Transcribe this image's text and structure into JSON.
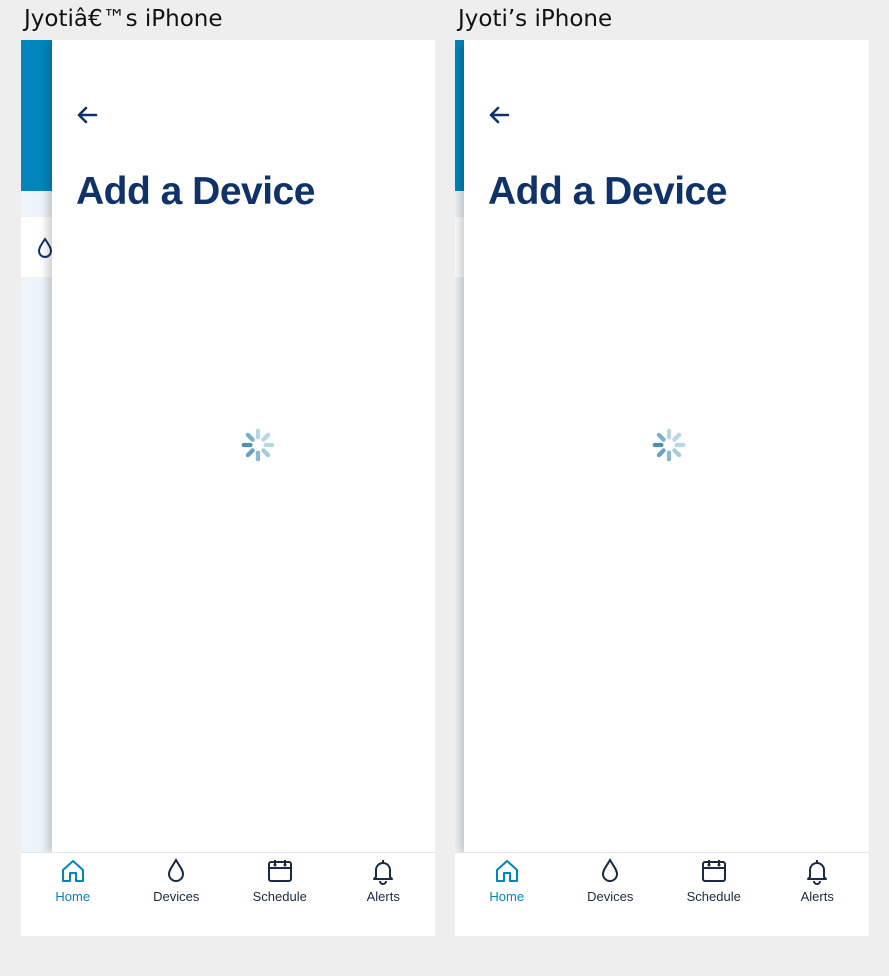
{
  "devices": [
    {
      "label": "Jyotiâ€™s iPhone",
      "title": "Add a Device",
      "tabs": [
        {
          "label": "Home",
          "icon": "home-icon",
          "active": true
        },
        {
          "label": "Devices",
          "icon": "water-drop-icon",
          "active": false
        },
        {
          "label": "Schedule",
          "icon": "calendar-icon",
          "active": false
        },
        {
          "label": "Alerts",
          "icon": "bell-icon",
          "active": false
        }
      ]
    },
    {
      "label": "Jyoti’s iPhone",
      "title": "Add a Device",
      "tabs": [
        {
          "label": "Home",
          "icon": "home-icon",
          "active": true
        },
        {
          "label": "Devices",
          "icon": "water-drop-icon",
          "active": false
        },
        {
          "label": "Schedule",
          "icon": "calendar-icon",
          "active": false
        },
        {
          "label": "Alerts",
          "icon": "bell-icon",
          "active": false
        }
      ]
    }
  ],
  "colors": {
    "brand_blue": "#0086bd",
    "title_navy": "#0f3268",
    "spinner": "#4f8fb0"
  }
}
